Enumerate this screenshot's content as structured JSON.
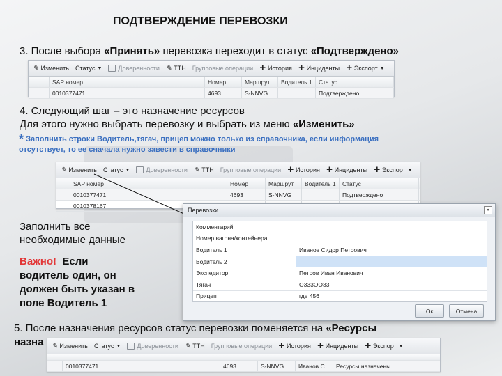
{
  "title": "ПОДТВЕРЖДЕНИЕ ПЕРЕВОЗКИ",
  "step3": {
    "pre": "3. После выбора ",
    "bold1": "«Принять»",
    "mid": " перевозка переходит в статус ",
    "bold2": "«Подтверждено»"
  },
  "step4": {
    "line1": "4. Следующий шаг – это назначение ресурсов",
    "line2_pre": "Для этого нужно выбрать перевозку и выбрать из меню ",
    "line2_bold": "«Изменить»"
  },
  "note": {
    "star": "*",
    "text1": "Заполнить строки Водитель,тягач, прицеп можно только из справочника, если информация",
    "text2": "отсутствует, то ее сначала нужно завести в справочники"
  },
  "fill": {
    "line1": "Заполнить все",
    "line2": "необходимые данные"
  },
  "important": {
    "label": "Важно!",
    "l1": "  Если",
    "l2": "водитель один, он",
    "l3": "должен быть указан в",
    "l4": "поле Водитель 1"
  },
  "step5": {
    "pre": "5. После назначения ресурсов статус перевозки поменяется на ",
    "bold": "«Ресурсы",
    "line2": "назна"
  },
  "toolbar": {
    "edit": "Изменить",
    "status": "Статус",
    "power": "Доверенности",
    "ttn": "ТТН",
    "group": "Групповые операции",
    "history": "История",
    "incidents": "Инциденты",
    "export": "Экспорт"
  },
  "grid": {
    "headers": [
      "SAP номер",
      "Номер",
      "Маршрут",
      "Водитель 1",
      "Статус"
    ],
    "grid1": [
      [
        "0010377471",
        "4693",
        "S-NNVG",
        "",
        "Подтверждено"
      ]
    ],
    "grid2": [
      [
        "0010377471",
        "4693",
        "S-NNVG",
        "",
        "Подтверждено"
      ],
      [
        "0010378167",
        "",
        "",
        "",
        ""
      ]
    ],
    "grid3": [
      [
        "0010377471",
        "4693",
        "S-NNVG",
        "Иванов С...",
        "Ресурсы назначены"
      ]
    ]
  },
  "dialog": {
    "title": "Перевозки",
    "fields": [
      {
        "label": "Комментарий",
        "value": ""
      },
      {
        "label": "Номер вагона/контейнера",
        "value": ""
      },
      {
        "label": "Водитель 1",
        "value": "Иванов Сидор Петрович"
      },
      {
        "label": "Водитель 2",
        "value": ""
      },
      {
        "label": "Экспедитор",
        "value": "Петров Иван Иванович"
      },
      {
        "label": "Тягач",
        "value": "О333ОО33"
      },
      {
        "label": "Прицеп",
        "value": "где 456"
      }
    ],
    "ok": "Ок",
    "cancel": "Отмена"
  }
}
